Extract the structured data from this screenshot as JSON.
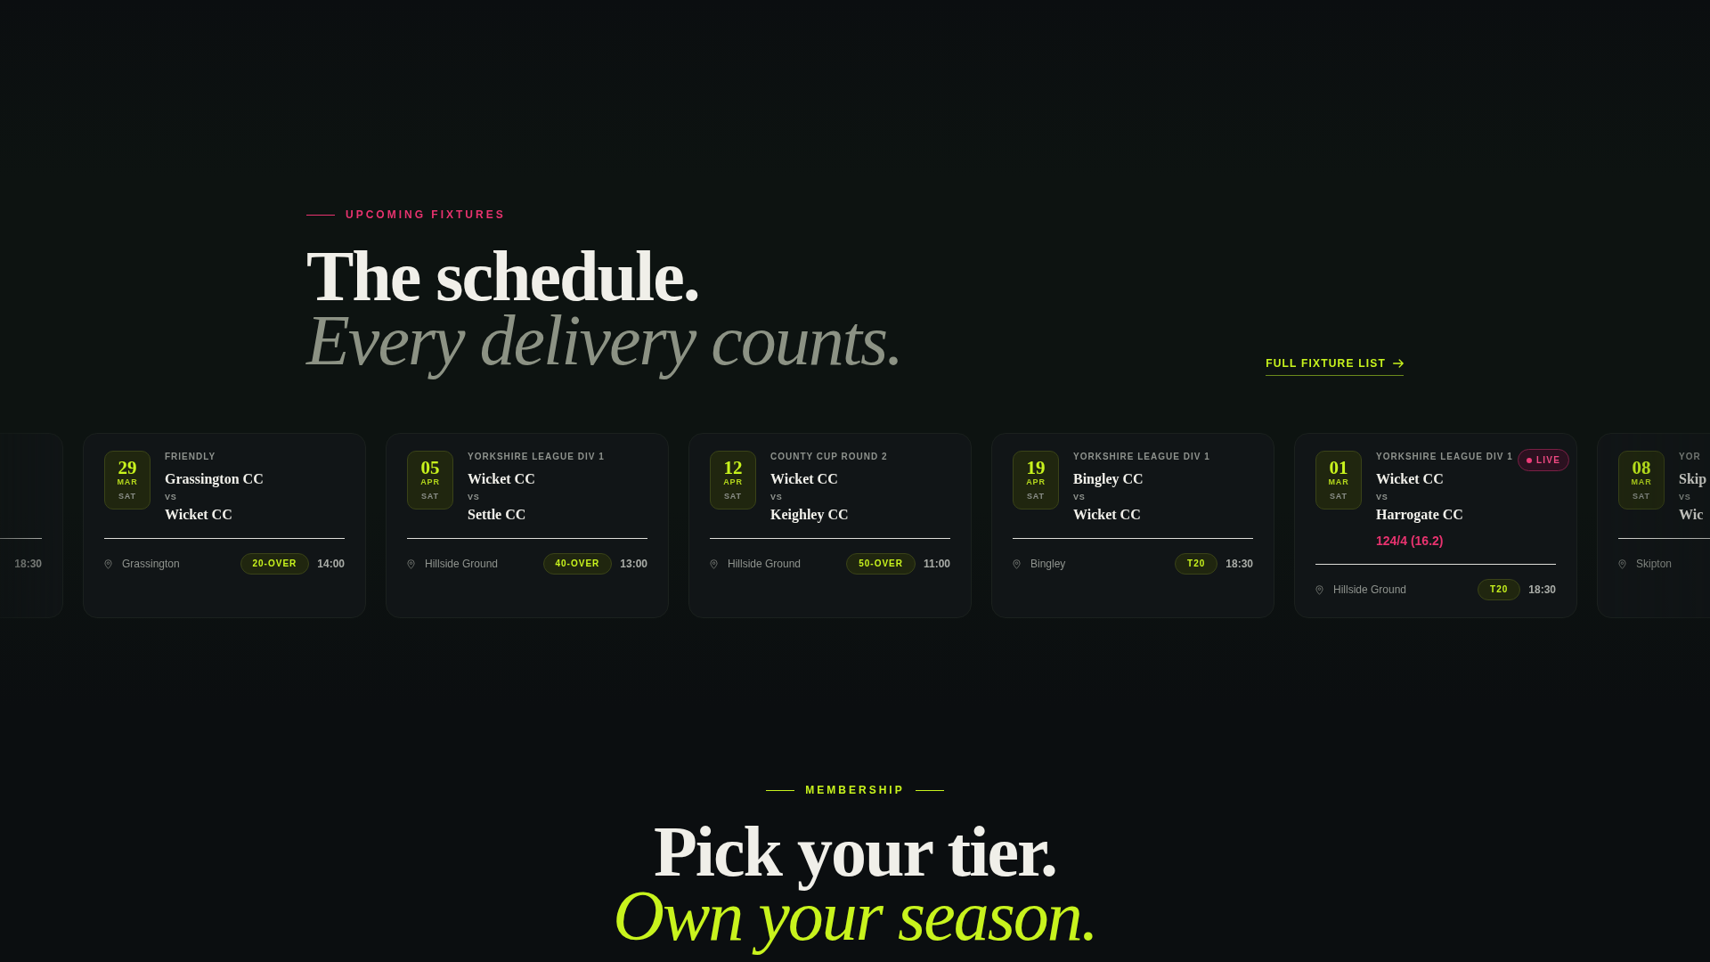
{
  "fixtures_section": {
    "eyebrow": "UPCOMING FIXTURES",
    "title": "The schedule.",
    "subtitle": "Every delivery counts.",
    "link": "FULL FIXTURE LIST"
  },
  "fixtures": [
    {
      "time": "18:30"
    },
    {
      "day": "29",
      "month": "MAR",
      "weekday": "SAT",
      "category": "FRIENDLY",
      "home": "Grassington CC",
      "vs": "VS",
      "away": "Wicket CC",
      "venue": "Grassington",
      "format": "20-OVER",
      "time": "14:00"
    },
    {
      "day": "05",
      "month": "APR",
      "weekday": "SAT",
      "category": "YORKSHIRE LEAGUE DIV 1",
      "home": "Wicket CC",
      "vs": "VS",
      "away": "Settle CC",
      "venue": "Hillside Ground",
      "format": "40-OVER",
      "time": "13:00"
    },
    {
      "day": "12",
      "month": "APR",
      "weekday": "SAT",
      "category": "COUNTY CUP ROUND 2",
      "home": "Wicket CC",
      "vs": "VS",
      "away": "Keighley CC",
      "venue": "Hillside Ground",
      "format": "50-OVER",
      "time": "11:00"
    },
    {
      "day": "19",
      "month": "APR",
      "weekday": "SAT",
      "category": "YORKSHIRE LEAGUE DIV 1",
      "home": "Bingley CC",
      "vs": "VS",
      "away": "Wicket CC",
      "venue": "Bingley",
      "format": "T20",
      "time": "18:30"
    },
    {
      "day": "01",
      "month": "MAR",
      "weekday": "SAT",
      "category": "YORKSHIRE LEAGUE DIV 1",
      "home": "Wicket CC",
      "vs": "VS",
      "away": "Harrogate CC",
      "score": "124/4 (16.2)",
      "venue": "Hillside Ground",
      "format": "T20",
      "time": "18:30",
      "live_badge": "LIVE"
    },
    {
      "day": "08",
      "month": "MAR",
      "weekday": "SAT",
      "category": "YOR",
      "home": "Skip",
      "vs": "VS",
      "away": "Wic",
      "venue": "Skipton"
    }
  ],
  "membership": {
    "eyebrow": "MEMBERSHIP",
    "title": "Pick your tier.",
    "subtitle": "Own your season."
  }
}
